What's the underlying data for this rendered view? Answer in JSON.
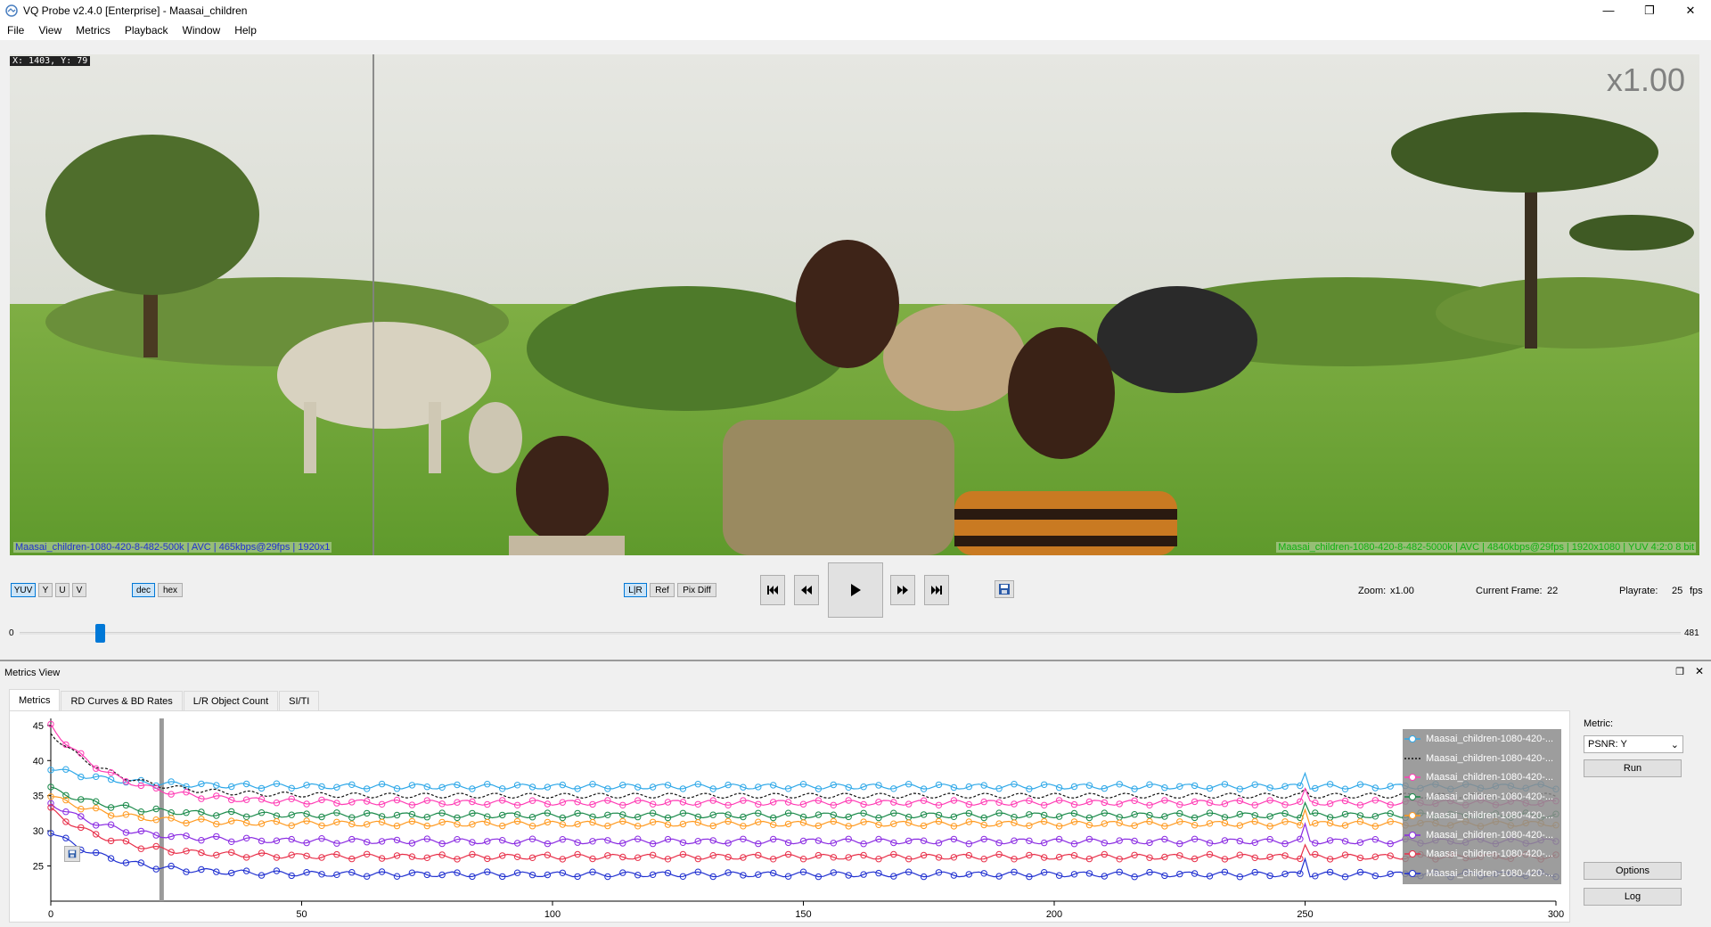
{
  "window": {
    "title": "VQ Probe v2.4.0 [Enterprise] - Maasai_children",
    "minimize": "—",
    "restore": "❐",
    "close": "✕"
  },
  "menu": [
    "File",
    "View",
    "Metrics",
    "Playback",
    "Window",
    "Help"
  ],
  "video": {
    "cursor_readout": "X: 1403, Y: 79",
    "zoom_overlay": "x1.00",
    "left_info": "Maasai_children-1080-420-8-482-500k | AVC | 465kbps@29fps | 1920x1",
    "right_info": "Maasai_children-1080-420-8-482-5000k | AVC | 4840kbps@29fps | 1920x1080 | YUV 4:2:0 8 bit"
  },
  "controls": {
    "channels": [
      "YUV",
      "Y",
      "U",
      "V"
    ],
    "number_format": [
      "dec",
      "hex"
    ],
    "compare_modes": [
      "L|R",
      "Ref",
      "Pix Diff"
    ],
    "save_icon": "save-icon",
    "zoom_label": "Zoom:",
    "zoom_value": "x1.00",
    "frame_label": "Current Frame:",
    "frame_value": "22",
    "playrate_label": "Playrate:",
    "playrate_value": "25",
    "playrate_unit": "fps"
  },
  "slider": {
    "min": "0",
    "max": "481",
    "position": 22
  },
  "metrics_view": {
    "title": "Metrics View",
    "tabs": [
      "Metrics",
      "RD Curves & BD Rates",
      "L/R Object Count",
      "SI/TI"
    ],
    "metric_label": "Metric:",
    "metric_value": "PSNR: Y",
    "run_label": "Run",
    "options_label": "Options",
    "log_label": "Log",
    "legend": [
      "Maasai_children-1080-420-...",
      "Maasai_children-1080-420-...",
      "Maasai_children-1080-420-...",
      "Maasai_children-1080-420-...",
      "Maasai_children-1080-420-...",
      "Maasai_children-1080-420-...",
      "Maasai_children-1080-420-...",
      "Maasai_children-1080-420-..."
    ]
  },
  "chart_data": {
    "type": "line",
    "xlim": [
      0,
      300
    ],
    "ylim": [
      21,
      46
    ],
    "x_ticks": [
      0,
      50,
      100,
      150,
      200,
      250,
      300
    ],
    "y_ticks": [
      25,
      30,
      35,
      40,
      45
    ],
    "current_frame": 22,
    "grid": false,
    "legend_position": "top-right",
    "series": [
      {
        "color": "#2fa8e8",
        "marker": "circle",
        "start": 39,
        "settle": 36.3,
        "spike": 38.2
      },
      {
        "color": "#111111",
        "marker": "dashed",
        "start": 44,
        "settle": 35.0,
        "spike": 36
      },
      {
        "color": "#ff3eb5",
        "marker": "circle",
        "start": 45,
        "settle": 34.0,
        "spike": 36
      },
      {
        "color": "#1a8a4a",
        "marker": "circle",
        "start": 36,
        "settle": 32.2,
        "spike": 34
      },
      {
        "color": "#ff9a20",
        "marker": "circle",
        "start": 35,
        "settle": 31.0,
        "spike": 33
      },
      {
        "color": "#8a2be2",
        "marker": "circle",
        "start": 34,
        "settle": 28.5,
        "spike": 31
      },
      {
        "color": "#e8304a",
        "marker": "circle",
        "start": 33,
        "settle": 26.3,
        "spike": 28
      },
      {
        "color": "#2030d0",
        "marker": "circle",
        "start": 30,
        "settle": 23.8,
        "spike": 26
      }
    ]
  }
}
